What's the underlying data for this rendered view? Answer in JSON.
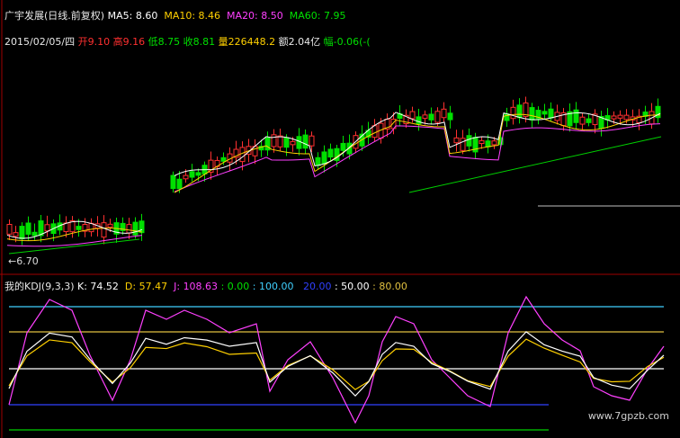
{
  "header": {
    "title": "广宇发展(日线.前复权)",
    "ma5_label": "MA5:",
    "ma5": "8.60",
    "ma10_label": "MA10:",
    "ma10": "8.46",
    "ma20_label": "MA20:",
    "ma20": "8.50",
    "ma60_label": "MA60:",
    "ma60": "7.95"
  },
  "info": {
    "date": "2015/02/05/四",
    "open_label": "开",
    "open": "9.10",
    "high_label": "高",
    "high": "9.16",
    "low_label": "低",
    "low": "8.75",
    "close_label": "收",
    "close": "8.81",
    "vol_label": "量",
    "vol": "226448.2",
    "amt_label": "额",
    "amt": "2.04亿",
    "chg_label": "幅",
    "chg": "-0.06(-("
  },
  "min_label": "←6.70",
  "kdj": {
    "name": "我的KDJ(9,3,3)",
    "k_label": "K:",
    "k": "74.52",
    "d_label": "D:",
    "d": "57.47",
    "j_label": "J:",
    "j": "108.63",
    "l0": ": 0.00",
    "l100": ": 100.00",
    "l20": "20.00",
    "l50": ": 50.00",
    "l80": ": 80.00"
  },
  "watermark": "www.7gpzb.com",
  "colors": {
    "up": "#ff3030",
    "down": "#00e000",
    "ma5": "#ffffff",
    "ma10": "#ffd000",
    "ma20": "#ff40ff",
    "ma60": "#00d000",
    "cyan": "#40d0ff",
    "blue": "#3040ff",
    "gold": "#e0c040",
    "grid": "#a00000"
  }
}
